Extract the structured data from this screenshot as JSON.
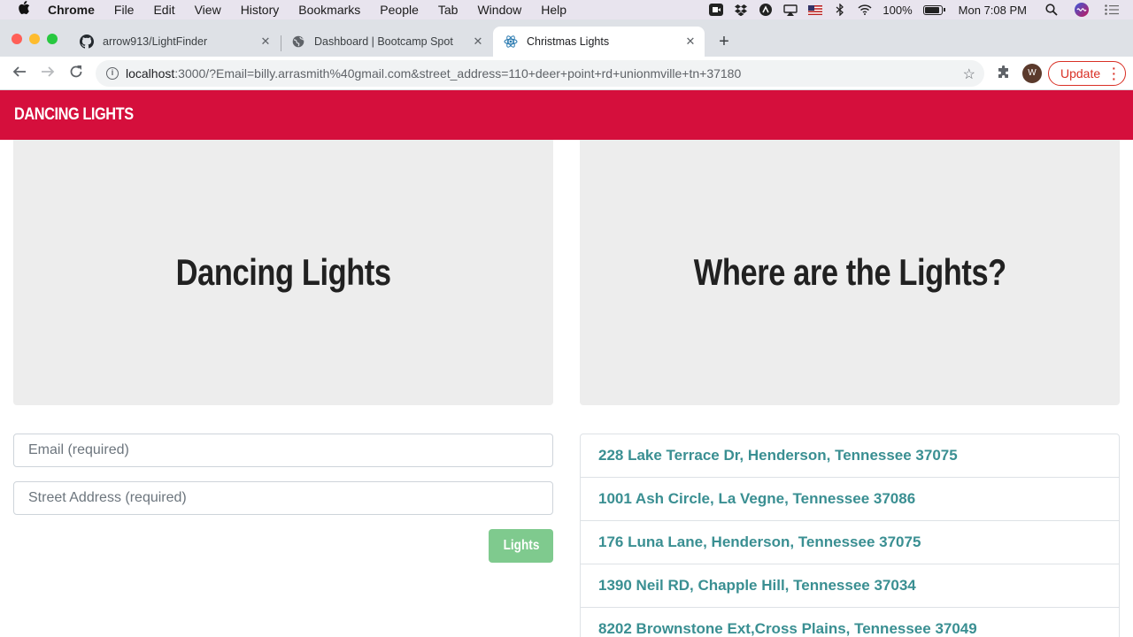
{
  "menubar": {
    "app_name": "Chrome",
    "items": [
      "File",
      "Edit",
      "View",
      "History",
      "Bookmarks",
      "People",
      "Tab",
      "Window",
      "Help"
    ],
    "battery": "100%",
    "clock": "Mon 7:08 PM"
  },
  "tabs": [
    {
      "title": "arrow913/LightFinder",
      "favicon": "github-icon"
    },
    {
      "title": "Dashboard | Bootcamp Spot",
      "favicon": "globe-icon"
    },
    {
      "title": "Christmas Lights",
      "favicon": "react-icon",
      "active": true
    }
  ],
  "toolbar": {
    "url_host": "localhost",
    "url_rest": ":3000/?Email=billy.arrasmith%40gmail.com&street_address=110+deer+point+rd+unionmville+tn+37180",
    "avatar_letter": "W",
    "update_label": "Update"
  },
  "app": {
    "brand": "DANCING LIGHTS",
    "left_heading": "Dancing Lights",
    "right_heading": "Where are the Lights?",
    "email_placeholder": "Email (required)",
    "address_placeholder": "Street Address (required)",
    "submit_label": "Lights",
    "addresses": [
      "228 Lake Terrace Dr, Henderson, Tennessee 37075",
      "1001 Ash Circle, La Vegne, Tennessee 37086",
      "176 Luna Lane, Henderson, Tennessee 37075",
      "1390 Neil RD, Chapple Hill, Tennessee 37034",
      "8202 Brownstone Ext,Cross Plains, Tennessee 37049"
    ]
  },
  "colors": {
    "navbar": "#d50f3c",
    "link": "#3a8f92",
    "button": "#7fca8e",
    "jumbotron": "#ededed"
  }
}
